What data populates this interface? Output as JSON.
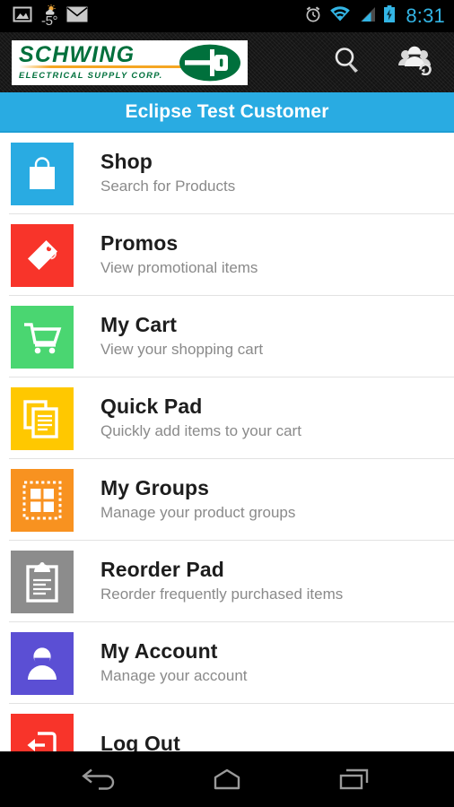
{
  "status_bar": {
    "icons_left": [
      "gallery-icon",
      "weather-icon",
      "email-icon"
    ],
    "weather_temp": "-5°",
    "icons_right": [
      "alarm-icon",
      "wifi-icon",
      "signal-icon",
      "battery-charging-icon"
    ],
    "time": "8:31",
    "accent_color": "#33b5e5",
    "background_color": "#000000"
  },
  "app_header": {
    "logo": {
      "name": "SCHWING",
      "subtitle": "ELECTRICAL SUPPLY CORP.",
      "brand_green": "#00703c",
      "brand_orange": "#f5a623",
      "mark": "plug-icon"
    },
    "actions": [
      {
        "name": "search-icon",
        "label": "Search"
      },
      {
        "name": "switch-customer-icon",
        "label": "Switch Customer"
      }
    ],
    "background_color": "#141414"
  },
  "title_bar": {
    "title": "Eclipse Test Customer",
    "background_color": "#29abe2",
    "text_color": "#ffffff"
  },
  "menu": {
    "items": [
      {
        "title": "Shop",
        "subtitle": "Search for Products",
        "icon": "shopping-bag-icon",
        "color": "#29abe2"
      },
      {
        "title": "Promos",
        "subtitle": "View promotional items",
        "icon": "price-tag-icon",
        "color": "#f8342a"
      },
      {
        "title": "My Cart",
        "subtitle": "View your shopping cart",
        "icon": "shopping-cart-icon",
        "color": "#4ad671"
      },
      {
        "title": "Quick Pad",
        "subtitle": "Quickly add items to your cart",
        "icon": "copy-documents-icon",
        "color": "#ffc800"
      },
      {
        "title": "My Groups",
        "subtitle": "Manage your product groups",
        "icon": "grid-groups-icon",
        "color": "#f89220"
      },
      {
        "title": "Reorder Pad",
        "subtitle": "Reorder frequently purchased items",
        "icon": "clipboard-icon",
        "color": "#8c8c8c"
      },
      {
        "title": "My Account",
        "subtitle": "Manage your account",
        "icon": "person-icon",
        "color": "#5b4fd4"
      },
      {
        "title": "Log Out",
        "subtitle": "",
        "icon": "logout-icon",
        "color": "#f8342a"
      }
    ]
  },
  "nav_bar": {
    "buttons": [
      {
        "name": "back-button",
        "icon": "back-arrow-icon"
      },
      {
        "name": "home-button",
        "icon": "home-icon"
      },
      {
        "name": "recents-button",
        "icon": "recents-icon"
      }
    ],
    "background_color": "#000000"
  }
}
